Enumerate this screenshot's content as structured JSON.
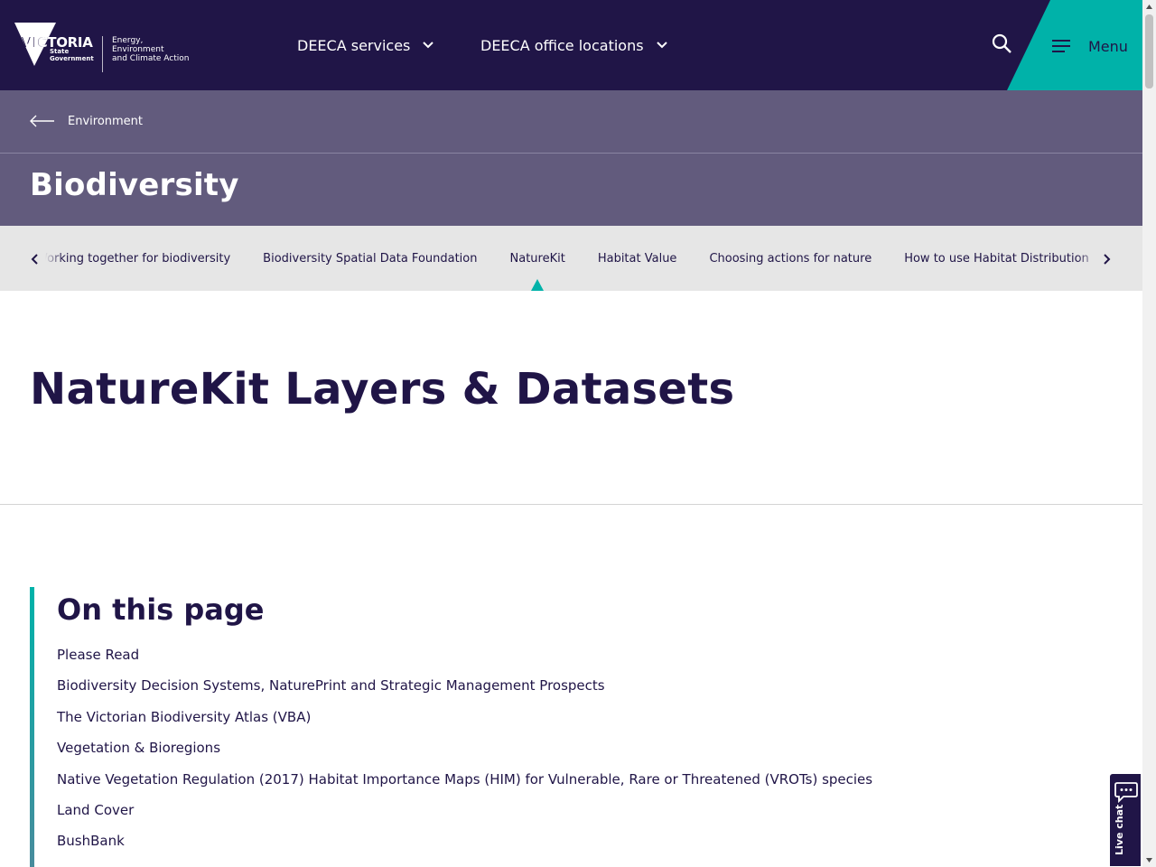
{
  "header": {
    "logo": {
      "wordmark": "VICTORIA",
      "state_lines": [
        "State",
        "Government"
      ],
      "dept_lines": [
        "Energy,",
        "Environment",
        "and Climate Action"
      ]
    },
    "nav": [
      {
        "label": "DEECA services"
      },
      {
        "label": "DEECA office locations"
      }
    ],
    "search_icon": "search-icon",
    "menu_label": "Menu",
    "accent_color": "#00b2a9",
    "bg_color": "#201547"
  },
  "breadcrumb": {
    "label": "Environment"
  },
  "section": {
    "title": "Biodiversity",
    "bg_color": "#625b7d"
  },
  "subnav": {
    "items": [
      {
        "label": "Working together for biodiversity"
      },
      {
        "label": "Biodiversity Spatial Data Foundation"
      },
      {
        "label": "NatureKit",
        "active": true
      },
      {
        "label": "Habitat Value"
      },
      {
        "label": "Choosing actions for nature"
      },
      {
        "label": "How to use Habitat Distribution"
      }
    ]
  },
  "main": {
    "title": "NatureKit Layers & Datasets"
  },
  "toc": {
    "title": "On this page",
    "items": [
      "Please Read",
      "Biodiversity Decision Systems, NaturePrint and Strategic Management Prospects",
      "The Victorian Biodiversity Atlas (VBA)",
      "Vegetation & Bioregions",
      "Native Vegetation Regulation (2017) Habitat Importance Maps (HIM) for Vulnerable, Rare or Threatened (VROTs) species",
      "Land Cover",
      "BushBank"
    ]
  },
  "livechat": {
    "label": "Live chat"
  }
}
